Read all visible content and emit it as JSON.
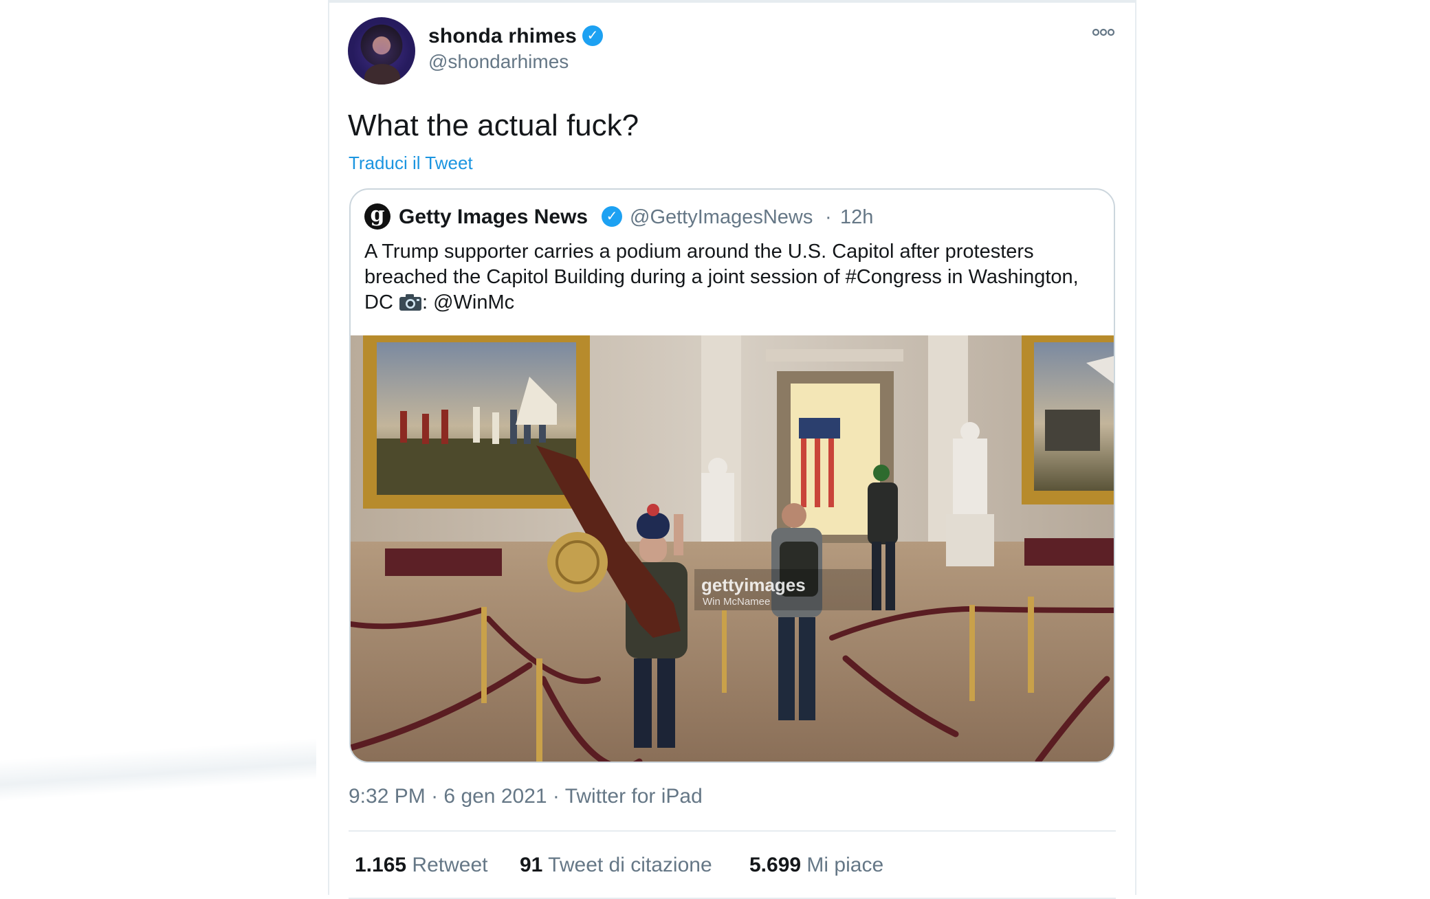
{
  "tweet": {
    "author_name": "shonda rhimes",
    "author_handle": "@shondarhimes",
    "text": "What the actual fuck?",
    "translate_label": "Traduci il Tweet",
    "time": "9:32 PM",
    "date": "6 gen 2021",
    "source": "Twitter for iPad",
    "separator": "·",
    "menu_icon": "more-horizontal-icon"
  },
  "quote": {
    "logo_letter": "g",
    "name": "Getty Images News",
    "handle": "@GettyImagesNews",
    "separator": "·",
    "time": "12h",
    "text_before_icon": "A Trump supporter carries a podium around the U.S. Capitol after protesters breached the Capitol Building during a joint session of #Congress in Washington, DC ",
    "text_after_icon": ": @WinMc",
    "photo": {
      "watermark_brand": "gettyimages",
      "watermark_credit": "Win McNamee"
    }
  },
  "stats": [
    {
      "count": "1.165",
      "label": "Retweet"
    },
    {
      "count": "91",
      "label": "Tweet di citazione"
    },
    {
      "count": "5.699",
      "label": "Mi piace"
    }
  ],
  "colors": {
    "link": "#1b95e0",
    "verified": "#1da1f2",
    "secondary_text": "#657786",
    "border": "#ccd6dd"
  }
}
